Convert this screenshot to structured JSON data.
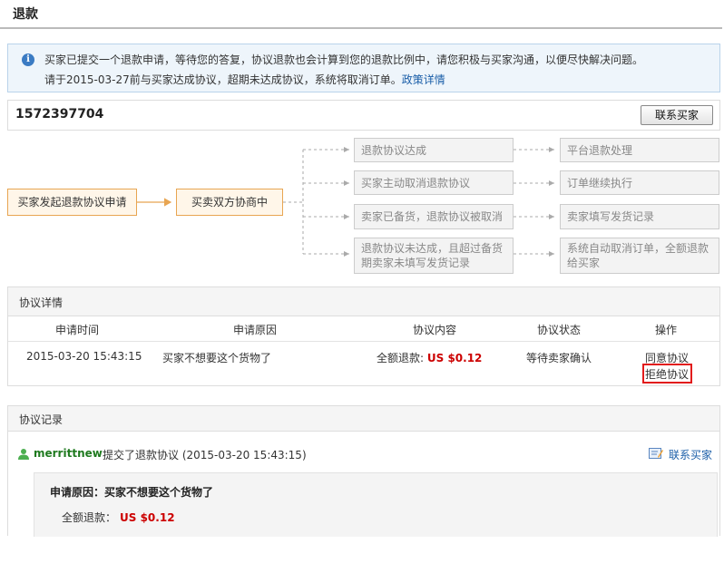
{
  "page": {
    "title": "退款"
  },
  "notice": {
    "line1": "买家已提交一个退款申请，等待您的答复，协议退款也会计算到您的退款比例中，请您积极与买家沟通，以便尽快解决问题。",
    "line2": "请于2015-03-27前与买家达成协议，超期未达成协议，系统将取消订单。",
    "link": "政策详情"
  },
  "order": {
    "id": "1572397704",
    "contact_button": "联系买家"
  },
  "flow": {
    "step1": "买家发起退款协议申请",
    "step2": "买卖双方协商中",
    "branches": [
      {
        "label": "退款协议达成",
        "result": "平台退款处理"
      },
      {
        "label": "买家主动取消退款协议",
        "result": "订单继续执行"
      },
      {
        "label": "卖家已备货，退款协议被取消",
        "result": "卖家填写发货记录"
      },
      {
        "label": "退款协议未达成，且超过备货期卖家未填写发货记录",
        "result": "系统自动取消订单，全额退款给买家"
      }
    ]
  },
  "detail": {
    "title": "协议详情",
    "columns": [
      "申请时间",
      "申请原因",
      "协议内容",
      "协议状态",
      "操作"
    ],
    "row": {
      "time": "2015-03-20 15:43:15",
      "reason": "买家不想要这个货物了",
      "content_label": "全额退款:",
      "content_amount": "US $0.12",
      "status": "等待卖家确认",
      "action_agree": "同意协议",
      "action_reject": "拒绝协议"
    }
  },
  "records": {
    "title": "协议记录",
    "user": "merrittnew",
    "action": "提交了退款协议 (2015-03-20 15:43:15)",
    "contact": "联系买家",
    "reason_line": "申请原因：买家不想要这个货物了",
    "amount_label": "全额退款：",
    "amount_value": "US $0.12"
  },
  "colors": {
    "accent_orange": "#e8a552",
    "link_blue": "#1a5ea8",
    "amount_red": "#cc0000",
    "highlight_red": "#e21b1b",
    "user_green": "#1f7a1f"
  }
}
